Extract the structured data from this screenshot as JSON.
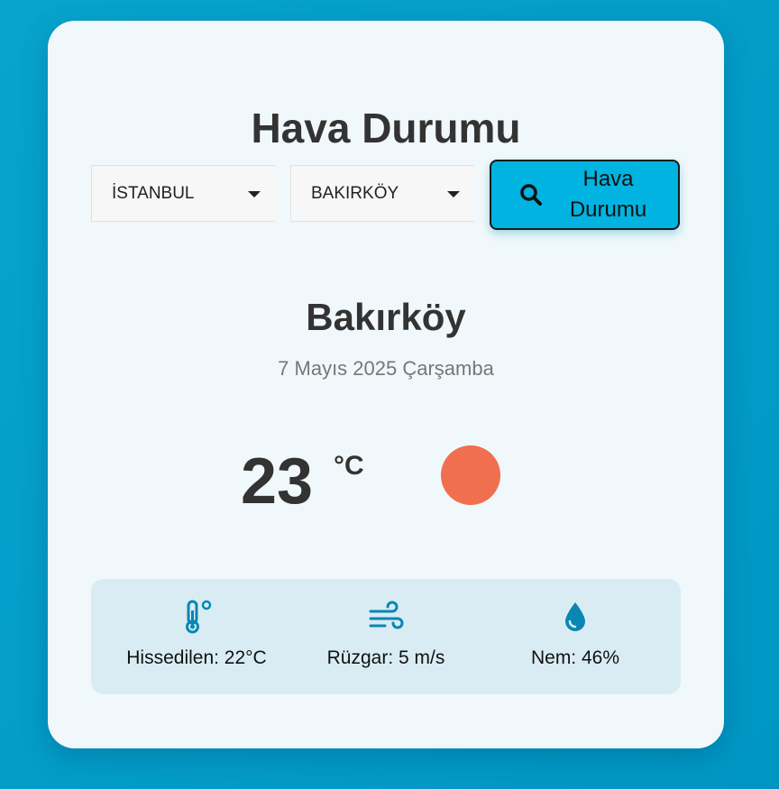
{
  "app": {
    "title": "Hava Durumu"
  },
  "controls": {
    "city_value": "İSTANBUL",
    "district_value": "BAKIRKÖY",
    "search_label": "Hava Durumu",
    "search_icon": "search-icon"
  },
  "weather": {
    "location": "Bakırköy",
    "date": "7 Mayıs 2025 Çarşamba",
    "temperature": "23",
    "unit": "°C",
    "condition_icon": "sun-icon"
  },
  "details": {
    "feels_like": "Hissedilen: 22°C",
    "wind": "Rüzgar: 5 m/s",
    "humidity": "Nem: 46%"
  },
  "colors": {
    "background": "#07a4cd",
    "card": "#f1f8fb",
    "button": "#00b3e0",
    "sun": "#ef6f4f",
    "icon": "#0a86b3",
    "details_panel": "#d9ecf3"
  }
}
